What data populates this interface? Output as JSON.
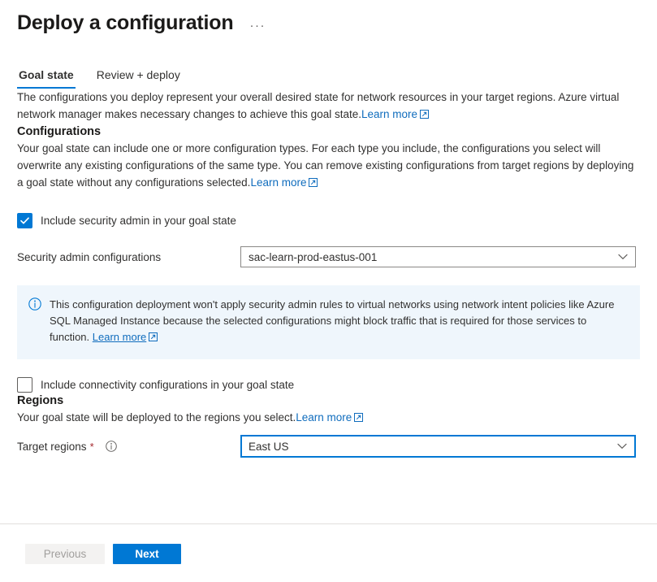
{
  "header": {
    "title": "Deploy a configuration",
    "more_label": "···"
  },
  "tabs": [
    {
      "label": "Goal state",
      "active": true
    },
    {
      "label": "Review + deploy",
      "active": false
    }
  ],
  "intro": {
    "text": "The configurations you deploy represent your overall desired state for network resources in your target regions. Azure virtual network manager makes necessary changes to achieve this goal state.",
    "learn_more": "Learn more"
  },
  "configurations": {
    "heading": "Configurations",
    "text": "Your goal state can include one or more configuration types. For each type you include, the configurations you select will overwrite any existing configurations of the same type. You can remove existing configurations from target regions by deploying a goal state without any configurations selected.",
    "learn_more": "Learn more",
    "security_admin_checkbox_label": "Include security admin in your goal state",
    "security_admin_checkbox_checked": "true",
    "security_admin_field_label": "Security admin configurations",
    "security_admin_value": "sac-learn-prod-eastus-001",
    "connectivity_checkbox_label": "Include connectivity configurations in your goal state",
    "connectivity_checkbox_checked": "false"
  },
  "info_banner": {
    "text": "This configuration deployment won't apply security admin rules to virtual networks using network intent policies like Azure SQL Managed Instance because the selected configurations might block traffic that is required for those services to function.",
    "learn_more": "Learn more"
  },
  "regions": {
    "heading": "Regions",
    "text": "Your goal state will be deployed to the regions you select.",
    "learn_more": "Learn more",
    "target_label": "Target regions",
    "required_mark": "*",
    "target_value": "East US"
  },
  "footer": {
    "previous_label": "Previous",
    "next_label": "Next"
  },
  "colors": {
    "accent": "#0078d4",
    "link": "#0f6cbd",
    "banner_bg": "#eff6fc",
    "required": "#a4262c",
    "text": "#323130"
  }
}
